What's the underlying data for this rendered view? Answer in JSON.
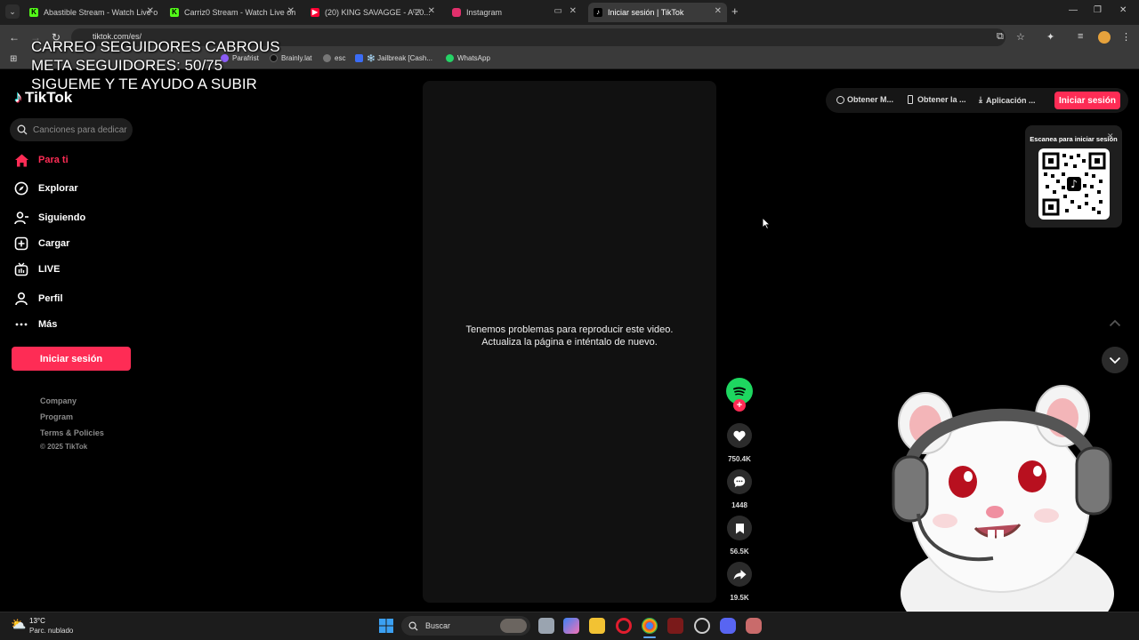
{
  "browser": {
    "tabs": [
      {
        "title": "Abastible Stream - Watch Live o",
        "icon": "kick-icon",
        "color": "#53fc18"
      },
      {
        "title": "Carriz0 Stream - Watch Live on",
        "icon": "kick-icon",
        "color": "#53fc18"
      },
      {
        "title": "(20) KING SAVAGGE - A 20...",
        "icon": "youtube-icon",
        "color": "#ff0033"
      },
      {
        "title": "Instagram",
        "icon": "instagram-icon",
        "color": "#e1306c"
      },
      {
        "title": "Iniciar sesión | TikTok",
        "icon": "tiktok-icon",
        "color": "#000000"
      }
    ],
    "url": "tiktok.com/es/",
    "bookmarks": [
      {
        "label": "Parafrist",
        "color": "#8b5cf6"
      },
      {
        "label": "Brainly.lat",
        "color": "#000000"
      },
      {
        "label": "esc",
        "color": "#777777"
      },
      {
        "label": "❄️ Jailbreak [Cash...",
        "color": "#3b6cf5"
      },
      {
        "label": "WhatsApp",
        "color": "#25d366"
      }
    ]
  },
  "overlay": {
    "line1": "CARREO SEGUIDORES CABROUS",
    "line2": "META SEGUIDORES: 50/75",
    "line3": "SIGUEME Y TE AYUDO A SUBIR"
  },
  "sidebar": {
    "logo": "TikTok",
    "search_placeholder": "Canciones para dedicar",
    "items": [
      {
        "label": "Para ti",
        "icon": "home-icon"
      },
      {
        "label": "Explorar",
        "icon": "compass-icon"
      },
      {
        "label": "Siguiendo",
        "icon": "following-icon"
      },
      {
        "label": "Cargar",
        "icon": "upload-icon"
      },
      {
        "label": "LIVE",
        "icon": "live-icon"
      },
      {
        "label": "Perfil",
        "icon": "profile-icon"
      },
      {
        "label": "Más",
        "icon": "more-icon"
      }
    ],
    "login_label": "Iniciar sesión",
    "footer": [
      "Company",
      "Program",
      "Terms & Policies",
      "© 2025 TikTok"
    ]
  },
  "video": {
    "message_line1": "Tenemos problemas para reproducir este video.",
    "message_line2": "Actualiza la página e inténtalo de nuevo."
  },
  "actions": {
    "likes": "750.4K",
    "comments": "1448",
    "saves": "56.5K",
    "shares": "19.5K"
  },
  "header": {
    "coins": "Obtener M...",
    "app": "Obtener la ...",
    "desktop": "Aplicación ...",
    "login": "Iniciar sesión"
  },
  "qr": {
    "title": "Escanea para iniciar sesión"
  },
  "taskbar": {
    "temperature": "13°C",
    "weather": "Parc. nublado",
    "search": "Buscar"
  }
}
